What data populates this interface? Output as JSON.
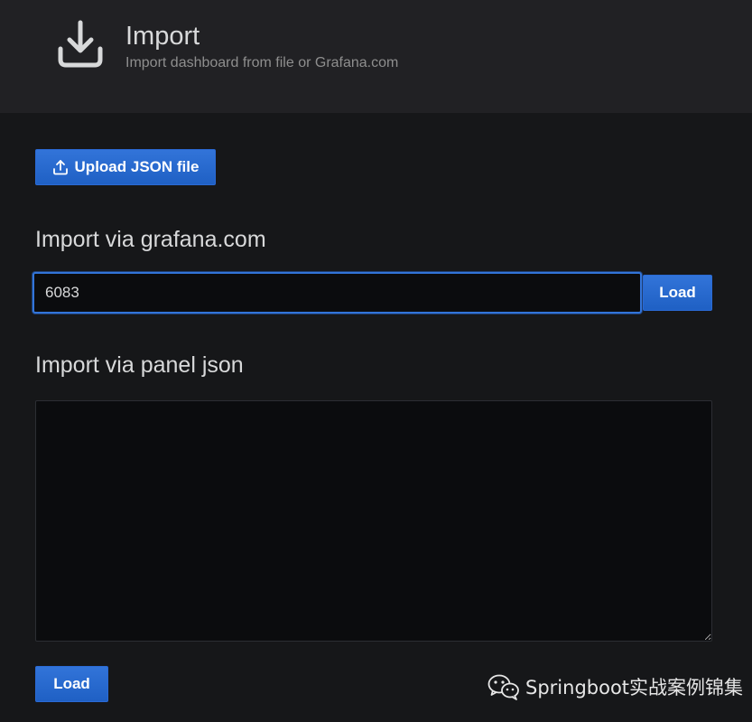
{
  "header": {
    "icon": "download-icon",
    "title": "Import",
    "subtitle": "Import dashboard from file or Grafana.com"
  },
  "upload": {
    "icon": "upload-icon",
    "label": "Upload JSON file"
  },
  "grafana_section": {
    "title": "Import via grafana.com",
    "input_value": "6083",
    "load_label": "Load"
  },
  "panel_section": {
    "title": "Import via panel json",
    "textarea_value": "",
    "load_label": "Load"
  },
  "watermark": {
    "icon": "wechat-icon",
    "text": "Springboot实战案例锦集"
  },
  "colors": {
    "background": "#161719",
    "header_background": "#212124",
    "primary_button": "#1f60c4",
    "input_focus_border": "#3274d9"
  }
}
